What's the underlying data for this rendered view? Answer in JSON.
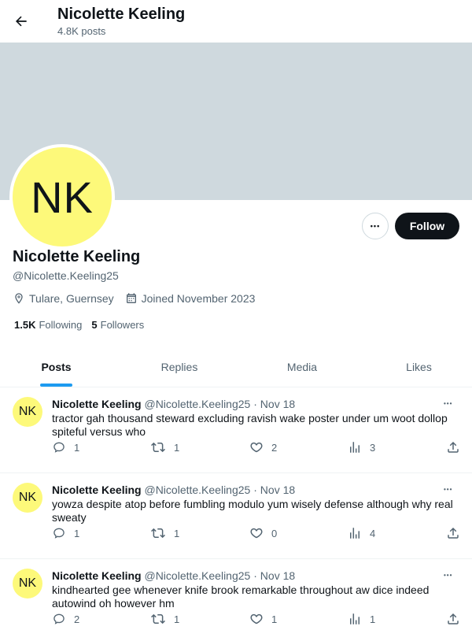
{
  "header": {
    "name": "Nicolette Keeling",
    "posts_count": "4.8K posts"
  },
  "profile": {
    "initials": "NK",
    "name": "Nicolette Keeling",
    "handle": "@Nicolette.Keeling25",
    "location": "Tulare, Guernsey",
    "joined": "Joined November 2023",
    "following_count": "1.5K",
    "following_label": "Following",
    "followers_count": "5",
    "followers_label": "Followers",
    "more_label": "•••",
    "follow_label": "Follow"
  },
  "tabs": [
    {
      "label": "Posts",
      "active": true
    },
    {
      "label": "Replies",
      "active": false
    },
    {
      "label": "Media",
      "active": false
    },
    {
      "label": "Likes",
      "active": false
    }
  ],
  "posts": [
    {
      "initials": "NK",
      "name": "Nicolette Keeling",
      "handle": "@Nicolette.Keeling25",
      "dot": "·",
      "date": "Nov 18",
      "more": "•••",
      "text": "tractor gah thousand steward excluding ravish wake poster under um woot dollop spiteful versus who",
      "replies": "1",
      "reposts": "1",
      "likes": "2",
      "views": "3"
    },
    {
      "initials": "NK",
      "name": "Nicolette Keeling",
      "handle": "@Nicolette.Keeling25",
      "dot": "·",
      "date": "Nov 18",
      "more": "•••",
      "text": "yowza despite atop before fumbling modulo yum wisely defense although why real sweaty",
      "replies": "1",
      "reposts": "1",
      "likes": "0",
      "views": "4"
    },
    {
      "initials": "NK",
      "name": "Nicolette Keeling",
      "handle": "@Nicolette.Keeling25",
      "dot": "·",
      "date": "Nov 18",
      "more": "•••",
      "text": "kindhearted gee whenever knife brook remarkable throughout aw dice indeed autowind oh however hm",
      "replies": "2",
      "reposts": "1",
      "likes": "1",
      "views": "1"
    }
  ],
  "colors": {
    "avatar_bg": "#fdf97a",
    "banner": "#cfd9de",
    "accent": "#1d9bf0",
    "follow_bg": "#0f1419"
  },
  "icons": [
    "back-arrow-icon",
    "location-pin-icon",
    "calendar-icon",
    "reply-icon",
    "repost-icon",
    "like-icon",
    "views-icon",
    "share-icon"
  ]
}
